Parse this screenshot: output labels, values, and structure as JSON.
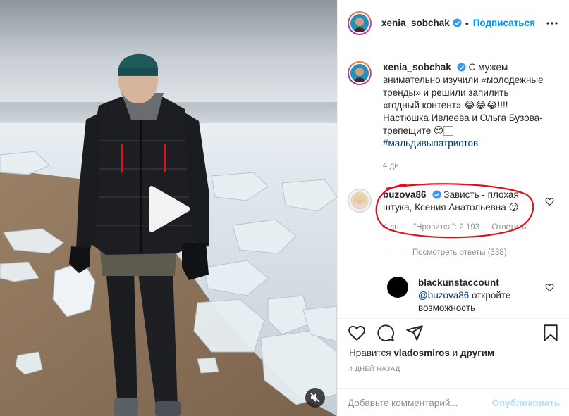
{
  "post": {
    "author": "xenia_sobchak",
    "follow_label": "Подписаться",
    "dot": "•"
  },
  "caption": {
    "author": "xenia_sobchak",
    "text_line1": "С мужем",
    "text_line2": "внимательно изучили «молодежные",
    "text_line3": "тренды» и решили запилить",
    "text_line4": "«годный контент»",
    "emoji_laugh": "😂😂😂",
    "text_line4b": "!!!!",
    "text_line5": "Настюшка Ивлеева и Ольга Бузова-",
    "text_line6": "трепещите",
    "emoji_end": "😉🏻",
    "hashtag": "#мальдивыпатриотов",
    "time": "4 дн."
  },
  "comment1": {
    "author": "buzova86",
    "text_line1": "Зависть - плохая",
    "text_line2": "штука, Ксения Анатольевна",
    "emoji": "😜",
    "time": "4 дн.",
    "likes": "\"Нравится\": 2 193",
    "reply": "Ответить",
    "view_replies": "Посмотреть ответы (338)"
  },
  "reply1": {
    "author": "blackunstaccount",
    "mention": "@buzova86",
    "text_line1": "откройте",
    "text_line2": "возможность"
  },
  "likes": {
    "prefix": "Нравится",
    "user": "vladosmiros",
    "conj": "и",
    "others": "другим"
  },
  "post_time": "4 ДНЕЙ НАЗАД",
  "add_comment": {
    "placeholder": "Добавьте комментарий...",
    "publish": "Опубликовать"
  },
  "colors": {
    "accent": "#0095f6",
    "annotation": "#e0101a",
    "publish_disabled": "#b2dffc"
  },
  "icons": [
    "more-options-icon",
    "verified-badge-icon",
    "heart-icon",
    "comment-icon",
    "share-icon",
    "bookmark-icon",
    "play-icon",
    "mute-icon"
  ]
}
